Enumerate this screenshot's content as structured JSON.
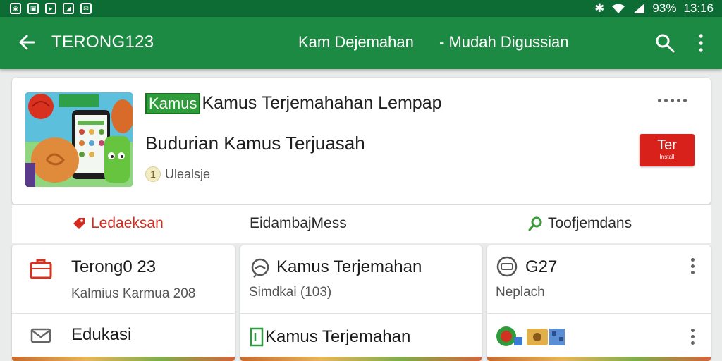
{
  "status_bar": {
    "battery": "93%",
    "time": "13:16"
  },
  "app_bar": {
    "title": "TERONG123",
    "subtitle_left": "Kam Dejemahan",
    "subtitle_right": "- Mudah Digussian"
  },
  "app_card": {
    "title_badge": "Kamus",
    "title": "Kamus Terjemahahan Lempap",
    "subtitle": "Budurian  Kamus Terjuasah",
    "meta_number": "1",
    "meta_label": "Ulealsje",
    "install_label": "Ter",
    "install_sub": "Install"
  },
  "tabs": [
    {
      "label": "Ledaeksan",
      "color": "#d42b1e"
    },
    {
      "label": "EidambajMess"
    },
    {
      "label": "Toofjemdans"
    }
  ],
  "tiles": {
    "a": {
      "title": "Terong0 23",
      "subtitle": "Kalmius Karmua 208",
      "bottom_label": "Edukasi"
    },
    "b": {
      "title": "Kamus Terjemahan",
      "subtitle": "Simdkai (103)",
      "bottom_label": "Kamus Terjemahan"
    },
    "c": {
      "title": "G27",
      "subtitle": "Neplach"
    }
  },
  "colors": {
    "status_bar": "#0d6b34",
    "app_bar": "#1d8a43",
    "accent_red": "#d8211b",
    "background": "#e9ecea"
  }
}
